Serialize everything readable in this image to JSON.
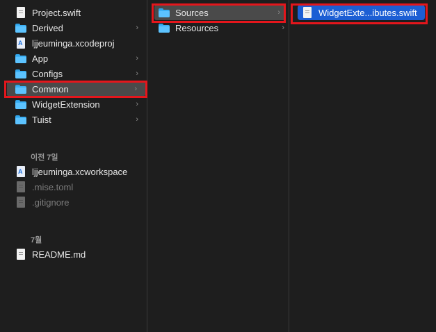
{
  "column1": {
    "items": [
      {
        "name": "Project.swift",
        "icon": "swift-file-icon"
      },
      {
        "name": "Derived",
        "icon": "folder-icon",
        "chevron": "›"
      },
      {
        "name": "ljjeuminga.xcodeproj",
        "icon": "xcodeproj-icon"
      },
      {
        "name": "App",
        "icon": "folder-icon",
        "chevron": "›"
      },
      {
        "name": "Configs",
        "icon": "folder-icon",
        "chevron": "›"
      },
      {
        "name": "Common",
        "icon": "folder-icon",
        "chevron": "›"
      },
      {
        "name": "WidgetExtension",
        "icon": "folder-icon",
        "chevron": "›"
      },
      {
        "name": "Tuist",
        "icon": "folder-icon",
        "chevron": "›"
      }
    ],
    "section_previous_7_days": "이전 7일",
    "recent_items": [
      {
        "name": "ljjeuminga.xcworkspace",
        "icon": "xcworkspace-icon"
      },
      {
        "name": ".mise.toml",
        "icon": "hidden-file-icon"
      },
      {
        "name": ".gitignore",
        "icon": "hidden-file-icon"
      }
    ],
    "section_july": "7월",
    "july_items": [
      {
        "name": "README.md",
        "icon": "markdown-file-icon"
      }
    ]
  },
  "column2": {
    "items": [
      {
        "name": "Sources",
        "icon": "folder-icon",
        "chevron": "›"
      },
      {
        "name": "Resources",
        "icon": "folder-icon",
        "chevron": "›"
      }
    ]
  },
  "column3": {
    "items": [
      {
        "name": "WidgetExte...ibutes.swift",
        "icon": "swift-file-icon"
      }
    ]
  },
  "colors": {
    "background": "#1e1e1e",
    "selection_grey": "#4a4a4a",
    "selection_blue": "#1c5ed4",
    "highlight_red": "#e4161c",
    "folder_blue": "#3bb0f5"
  }
}
